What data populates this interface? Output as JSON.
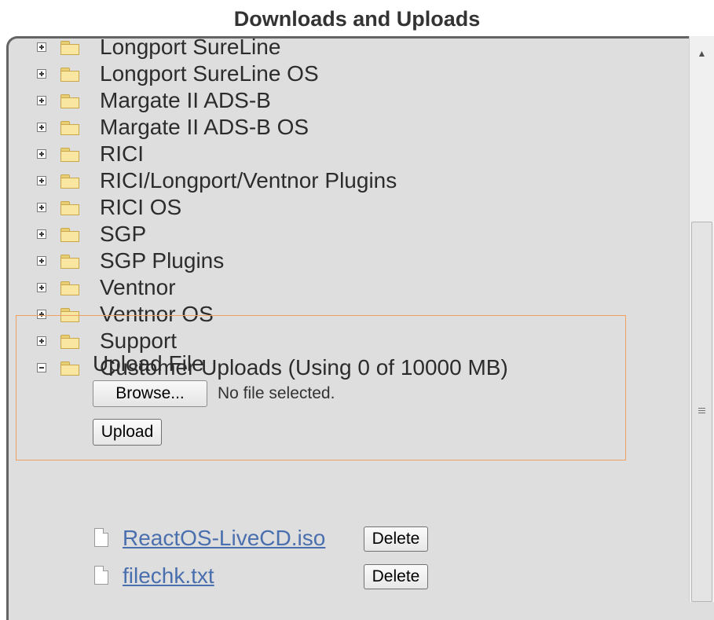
{
  "page": {
    "title": "Downloads and Uploads"
  },
  "tree": {
    "items": [
      {
        "label": "Longport SureLine",
        "expanded": false
      },
      {
        "label": "Longport SureLine OS",
        "expanded": false
      },
      {
        "label": "Margate II ADS-B",
        "expanded": false
      },
      {
        "label": "Margate II ADS-B OS",
        "expanded": false
      },
      {
        "label": "RICI",
        "expanded": false
      },
      {
        "label": "RICI/Longport/Ventnor Plugins",
        "expanded": false
      },
      {
        "label": "RICI OS",
        "expanded": false
      },
      {
        "label": "SGP",
        "expanded": false
      },
      {
        "label": "SGP Plugins",
        "expanded": false
      },
      {
        "label": "Ventnor",
        "expanded": false
      },
      {
        "label": "Ventnor OS",
        "expanded": false
      },
      {
        "label": "Support",
        "expanded": false
      },
      {
        "label": "Customer Uploads (Using 0 of 10000 MB)",
        "expanded": true
      }
    ]
  },
  "upload": {
    "title": "Upload File",
    "browse_label": "Browse...",
    "no_file_text": "No file selected.",
    "upload_label": "Upload"
  },
  "files": [
    {
      "name": "ReactOS-LiveCD.iso",
      "delete_label": "Delete"
    },
    {
      "name": "filechk.txt",
      "delete_label": "Delete"
    }
  ],
  "scrollbar": {
    "up_arrow": "▲"
  },
  "colors": {
    "panel": "#dedede",
    "highlight_border": "#f0a060",
    "link": "#4a6fae"
  }
}
